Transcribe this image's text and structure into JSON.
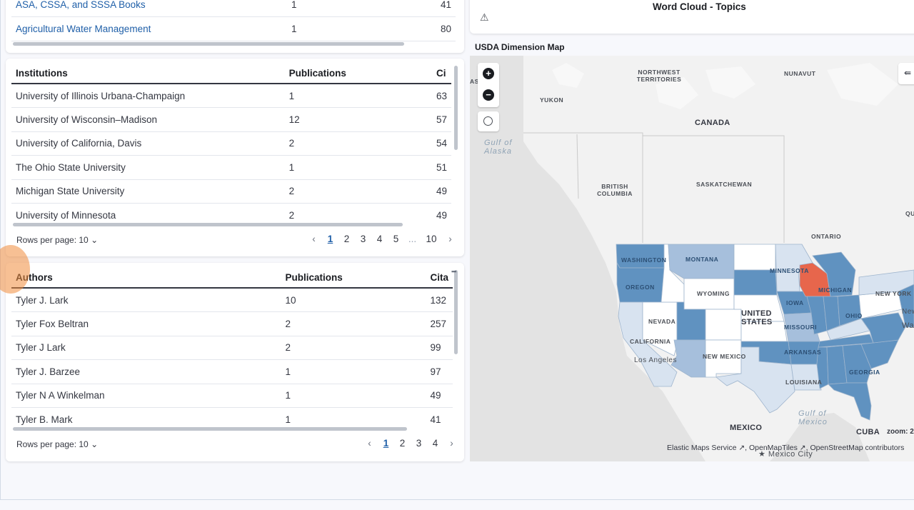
{
  "top_table": {
    "rows": [
      {
        "name": "ASA, CSSA, and SSSA Books",
        "pubs": "1",
        "cit": "41"
      },
      {
        "name": "Agricultural Water Management",
        "pubs": "1",
        "cit": "80"
      }
    ]
  },
  "institutions": {
    "headers": {
      "name": "Institutions",
      "pubs": "Publications",
      "cit": "Ci"
    },
    "rows": [
      {
        "name": "University of Illinois Urbana-Champaign",
        "pubs": "1",
        "cit": "63"
      },
      {
        "name": "University of Wisconsin–Madison",
        "pubs": "12",
        "cit": "57"
      },
      {
        "name": "University of California, Davis",
        "pubs": "2",
        "cit": "54"
      },
      {
        "name": "The Ohio State University",
        "pubs": "1",
        "cit": "51"
      },
      {
        "name": "Michigan State University",
        "pubs": "2",
        "cit": "49"
      },
      {
        "name": "University of Minnesota",
        "pubs": "2",
        "cit": "49"
      }
    ],
    "rows_per_page": "Rows per page: 10",
    "pages": [
      "1",
      "2",
      "3",
      "4",
      "5",
      "...",
      "10"
    ]
  },
  "authors": {
    "headers": {
      "name": "Authors",
      "pubs": "Publications",
      "cit": "Cita"
    },
    "rows": [
      {
        "name": "Tyler J. Lark",
        "pubs": "10",
        "cit": "132"
      },
      {
        "name": "Tyler Fox Beltran",
        "pubs": "2",
        "cit": "257"
      },
      {
        "name": "Tyler J Lark",
        "pubs": "2",
        "cit": "99"
      },
      {
        "name": "Tyler J. Barzee",
        "pubs": "1",
        "cit": "97"
      },
      {
        "name": "Tyler N A Winkelman",
        "pubs": "1",
        "cit": "49"
      },
      {
        "name": "Tyler B. Mark",
        "pubs": "1",
        "cit": "41"
      }
    ],
    "rows_per_page": "Rows per page: 10",
    "pages": [
      "1",
      "2",
      "3",
      "4"
    ]
  },
  "word_cloud": {
    "title": "Word Cloud - Topics",
    "warning_icon": "warning-icon"
  },
  "map": {
    "title": "USDA Dimension Map",
    "labels": {
      "nw_territories": "NORTHWEST TERRITORIES",
      "nunavut": "NUNAVUT",
      "yukon": "YUKON",
      "canada": "CANADA",
      "gulf_alaska": "Gulf of Alaska",
      "bc": "BRITISH COLUMBIA",
      "sask": "SASKATCHEWAN",
      "qu": "QU",
      "ontario": "ONTARIO",
      "washington": "WASHINGTON",
      "montana": "MONTANA",
      "oregon": "OREGON",
      "wyoming": "WYOMING",
      "minnesota": "MINNESOTA",
      "michigan": "MICHIGAN",
      "new_york": "NEW YORK",
      "iowa": "IOWA",
      "nevada": "NEVADA",
      "united_states": "UNITED STATES",
      "missouri": "MISSOURI",
      "ohio": "OHIO",
      "california": "CALIFORNIA",
      "los_angeles": "Los Angeles",
      "new_mexico": "NEW MEXICO",
      "arkansas": "ARKANSAS",
      "georgia": "GEORGIA",
      "louisiana": "LOUISIANA",
      "gulf_mexico": "Gulf of Mexico",
      "mexico": "MEXICO",
      "mexico_city": "★ Mexico City",
      "cuba": "CUBA",
      "new_x": "New",
      "wash_x": "Wash",
      "as": "AS"
    },
    "zoom": "zoom: 2",
    "attribution": "Elastic Maps Service ↗, OpenMapTiles ↗, OpenStreetMap contributors",
    "colors": {
      "dark": "#6092c0",
      "mid": "#a6bfdc",
      "light": "#d8e3f0",
      "hot": "#e7664c",
      "white": "#ffffff"
    }
  }
}
